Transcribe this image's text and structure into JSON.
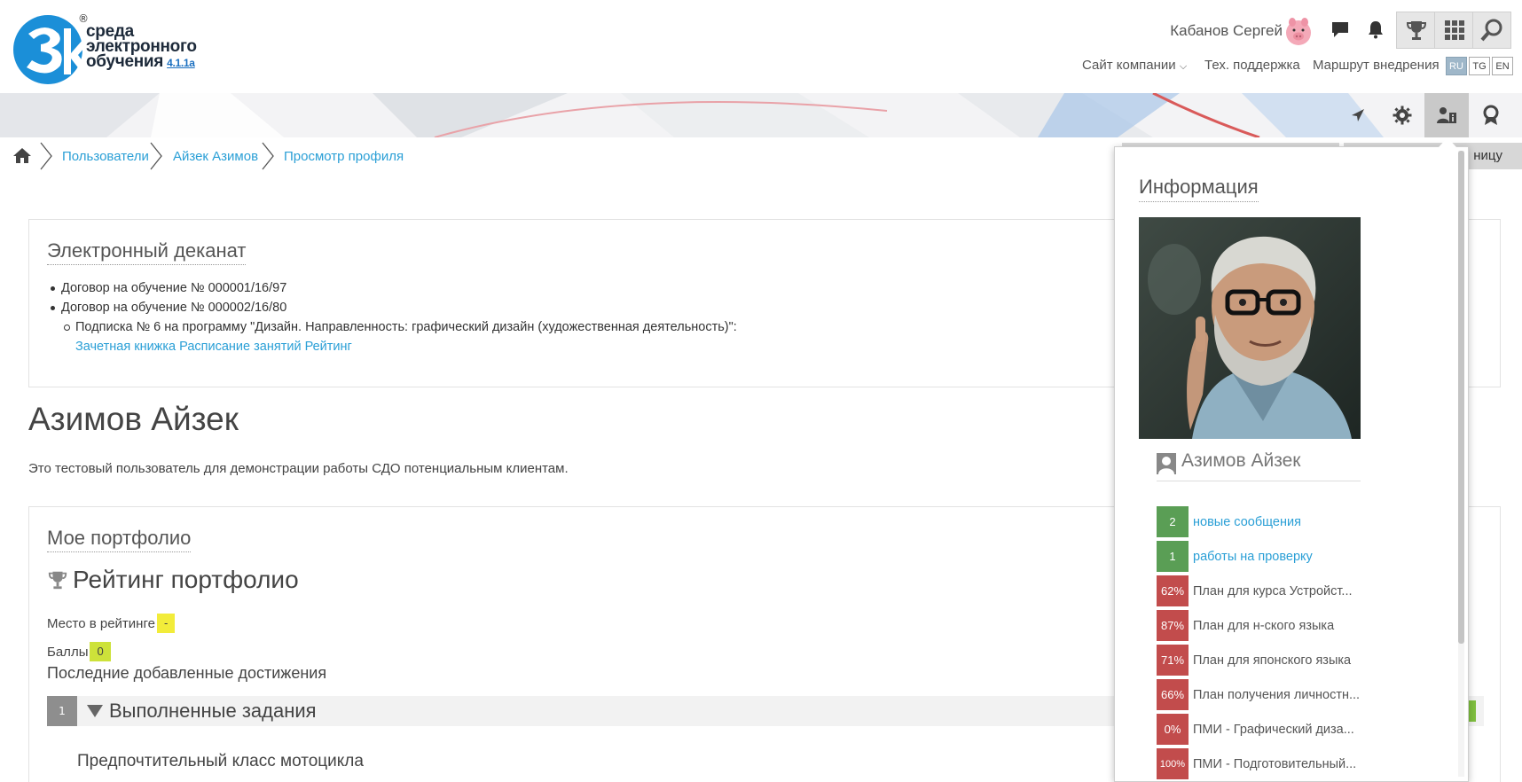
{
  "logo": {
    "line1": "среда",
    "line2": "электронного",
    "line3": "обучения",
    "version": "4.1.1a",
    "reg_mark": "®"
  },
  "header": {
    "user_name": "Кабанов Сергей",
    "links": {
      "company_site": "Сайт компании",
      "support": "Тех. поддержка",
      "route": "Маршрут внедрения"
    },
    "languages": [
      "RU",
      "TG",
      "EN"
    ],
    "active_language": "RU"
  },
  "icons": {
    "messages": "chat-bubble-icon",
    "notifications": "bell-icon",
    "achievements": "trophy-icon",
    "apps": "grid-icon",
    "search": "search-icon",
    "banner": [
      "pin-icon",
      "gear-icon",
      "user-info-icon",
      "badge-icon"
    ]
  },
  "breadcrumb": {
    "home_icon": "home-icon",
    "items": [
      "Пользователи",
      "Айзек Азимов",
      "Просмотр профиля"
    ]
  },
  "peek_button": "ницу",
  "dekanat": {
    "title": "Электронный деканат",
    "contracts": [
      "Договор на обучение № 000001/16/97",
      "Договор на обучение № 000002/16/80"
    ],
    "subscription": "Подписка № 6 на программу \"Дизайн. Направленность: графический дизайн (художественная деятельность)\":",
    "links": [
      "Зачетная книжка",
      "Расписание занятий",
      "Рейтинг"
    ]
  },
  "profile": {
    "name": "Азимов Айзек",
    "description": "Это тестовый пользователь для демонстрации работы СДО потенциальным клиентам."
  },
  "portfolio": {
    "title": "Мое портфолио",
    "rating_title": "Рейтинг портфолио",
    "place_label": "Место в рейтинге",
    "place_value": "-",
    "score_label": "Баллы",
    "score_value": "0",
    "latest_title": "Последние добавленные достижения",
    "completed": {
      "count": "1",
      "label": "Выполненные задания"
    },
    "item_title": "Предпочтительный класс мотоцикла"
  },
  "info_panel": {
    "title": "Информация",
    "user_name": "Азимов Айзек",
    "rows": [
      {
        "badge": "2",
        "label": "новые сообщения",
        "kind": "green",
        "link": true
      },
      {
        "badge": "1",
        "label": "работы на проверку",
        "kind": "green",
        "link": true
      },
      {
        "badge": "62%",
        "label": "План для курса Устройст...",
        "kind": "red",
        "link": false
      },
      {
        "badge": "87%",
        "label": "План для н-ского языка",
        "kind": "red",
        "link": false
      },
      {
        "badge": "71%",
        "label": "План для японского языка",
        "kind": "red",
        "link": false
      },
      {
        "badge": "66%",
        "label": "План получения личностн...",
        "kind": "red",
        "link": false
      },
      {
        "badge": "0%",
        "label": "ПМИ - Графический диза...",
        "kind": "red",
        "link": false
      },
      {
        "badge": "100%",
        "label": "ПМИ - Подготовительный...",
        "kind": "red",
        "link": false
      }
    ]
  },
  "colors": {
    "link": "#2a9fd6",
    "badge_green": "#5a9e55",
    "badge_red": "#c24c4c",
    "highlight_yellow": "#f2ec3a",
    "highlight_lime": "#cde23a"
  }
}
